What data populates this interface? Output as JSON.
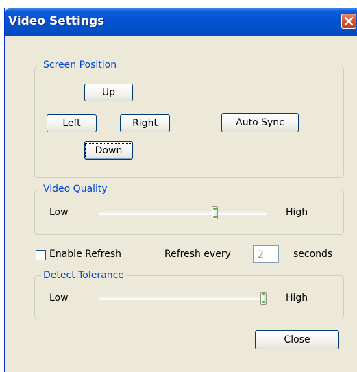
{
  "window": {
    "title": "Video Settings",
    "close_icon": "close-x-icon"
  },
  "screen_position": {
    "legend": "Screen Position",
    "up": "Up",
    "left": "Left",
    "right": "Right",
    "down": "Down",
    "auto_sync": "Auto Sync"
  },
  "video_quality": {
    "legend": "Video Quality",
    "low": "Low",
    "high": "High",
    "level_fraction": 0.7
  },
  "refresh": {
    "enable_label": "Enable Refresh",
    "enable_checked": false,
    "every_label": "Refresh every",
    "value": "2",
    "unit": "seconds"
  },
  "detect_tolerance": {
    "legend": "Detect Tolerance",
    "low": "Low",
    "high": "High",
    "level_fraction": 1.0
  },
  "footer": {
    "close": "Close"
  }
}
